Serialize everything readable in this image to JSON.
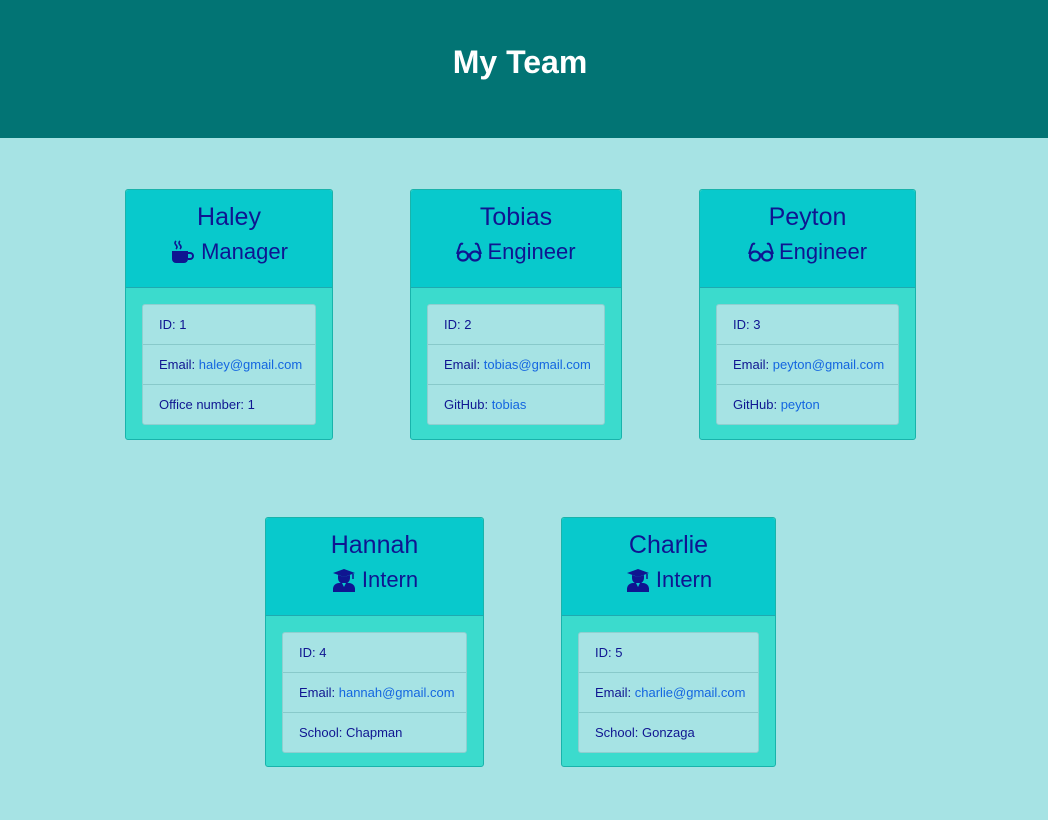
{
  "header": {
    "title": "My Team"
  },
  "team": [
    {
      "name": "Haley",
      "role": "Manager",
      "icon": "mug-hot-icon",
      "id_label": "ID: ",
      "id": "1",
      "email_label": "Email: ",
      "email": "haley@gmail.com",
      "extra_label": "Office number: ",
      "extra": "1"
    },
    {
      "name": "Tobias",
      "role": "Engineer",
      "icon": "glasses-icon",
      "id_label": "ID: ",
      "id": "2",
      "email_label": "Email: ",
      "email": "tobias@gmail.com",
      "extra_label": "GitHub: ",
      "extra": "tobias"
    },
    {
      "name": "Peyton",
      "role": "Engineer",
      "icon": "glasses-icon",
      "id_label": "ID: ",
      "id": "3",
      "email_label": "Email: ",
      "email": "peyton@gmail.com",
      "extra_label": "GitHub: ",
      "extra": "peyton"
    },
    {
      "name": "Hannah",
      "role": "Intern",
      "icon": "graduate-icon",
      "id_label": "ID: ",
      "id": "4",
      "email_label": "Email: ",
      "email": "hannah@gmail.com",
      "extra_label": "School: ",
      "extra": "Chapman"
    },
    {
      "name": "Charlie",
      "role": "Intern",
      "icon": "graduate-icon",
      "id_label": "ID: ",
      "id": "5",
      "email_label": "Email: ",
      "email": "charlie@gmail.com",
      "extra_label": "School: ",
      "extra": "Gonzaga"
    }
  ],
  "colors": {
    "header_bg": "#027474",
    "page_bg": "#a6e3e4",
    "card_head_bg": "#08c9cc",
    "card_body_bg": "#3bdbcd",
    "text": "#0f1591",
    "link": "#1466e0"
  }
}
